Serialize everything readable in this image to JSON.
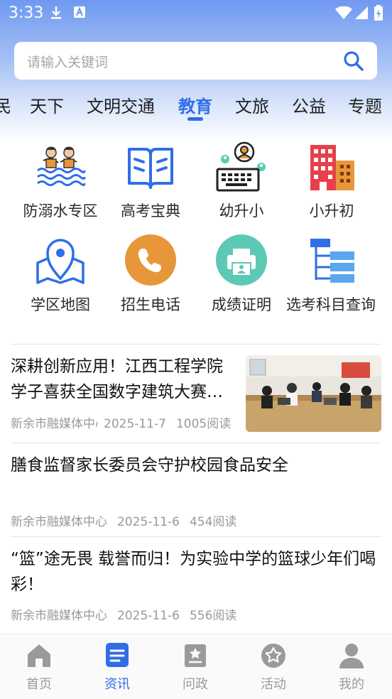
{
  "status_bar": {
    "time": "3:33"
  },
  "search": {
    "placeholder": "请输入关键词"
  },
  "tabs": [
    {
      "label": "民"
    },
    {
      "label": "天下"
    },
    {
      "label": "文明交通"
    },
    {
      "label": "教育"
    },
    {
      "label": "文旅"
    },
    {
      "label": "公益"
    },
    {
      "label": "专题"
    }
  ],
  "active_tab": "教育",
  "grid": [
    {
      "label": "防溺水专区",
      "icon": "swimmers-icon"
    },
    {
      "label": "高考宝典",
      "icon": "book-icon"
    },
    {
      "label": "幼升小",
      "icon": "kid-keyboard-icon"
    },
    {
      "label": "小升初",
      "icon": "building-icon"
    },
    {
      "label": "学区地图",
      "icon": "map-pin-icon"
    },
    {
      "label": "招生电话",
      "icon": "phone-icon"
    },
    {
      "label": "成绩证明",
      "icon": "printer-icon"
    },
    {
      "label": "选考科目查询",
      "icon": "tree-icon"
    }
  ],
  "news": [
    {
      "title": "深耕创新应用！江西工程学院学子喜获全国数字建筑大赛…",
      "source": "新余市融媒体中心",
      "date": "2025-11-7",
      "reads": "1005阅读",
      "has_image": true
    },
    {
      "title": "膳食监督家长委员会守护校园食品安全",
      "source": "新余市融媒体中心",
      "date": "2025-11-6",
      "reads": "454阅读",
      "has_image": false
    },
    {
      "title": "“篮”途无畏 载誉而归！为实验中学的篮球少年们喝彩！",
      "source": "新余市融媒体中心",
      "date": "2025-11-6",
      "reads": "556阅读",
      "has_image": false
    }
  ],
  "bottom_nav": [
    {
      "label": "首页",
      "icon": "home-icon"
    },
    {
      "label": "资讯",
      "icon": "news-icon"
    },
    {
      "label": "问政",
      "icon": "inquiry-icon"
    },
    {
      "label": "活动",
      "icon": "star-icon"
    },
    {
      "label": "我的",
      "icon": "profile-icon"
    }
  ],
  "active_nav": "资讯",
  "colors": {
    "accent": "#2f6ee6",
    "orange": "#e8963a",
    "teal": "#5cc9b4",
    "red": "#e8404a"
  }
}
